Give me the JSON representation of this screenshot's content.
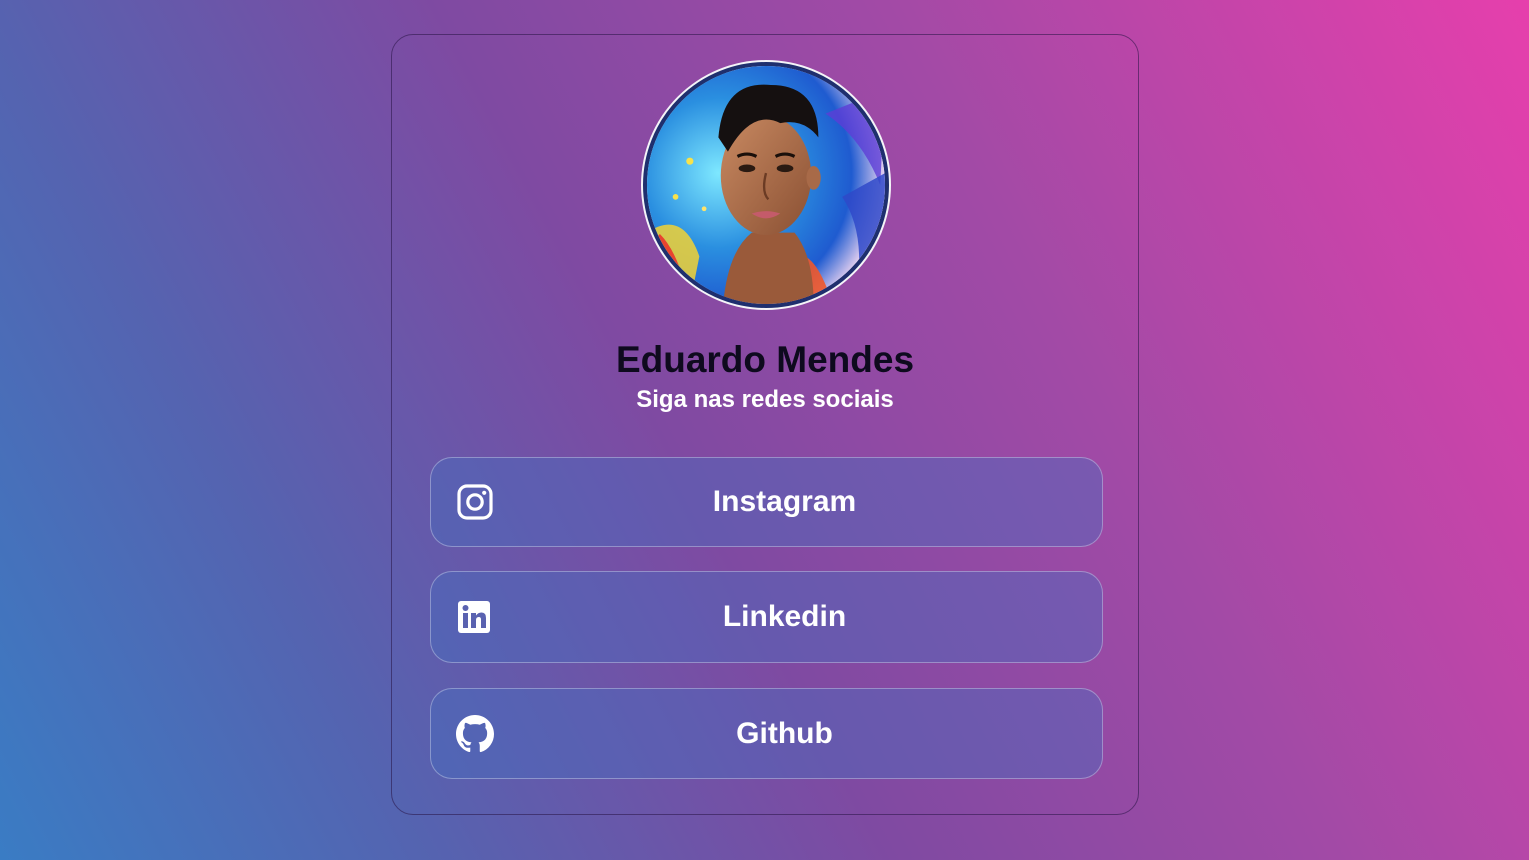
{
  "profile": {
    "name": "Eduardo Mendes",
    "subtitle": "Siga nas redes sociais",
    "avatar_icon": "profile-photo"
  },
  "links": [
    {
      "label": "Instagram",
      "icon": "instagram-icon"
    },
    {
      "label": "Linkedin",
      "icon": "linkedin-icon"
    },
    {
      "label": "Github",
      "icon": "github-icon"
    }
  ],
  "colors": {
    "background_start": "#3a7cc4",
    "background_end": "#e63fac",
    "name_text": "#0e0a1e",
    "button_text": "#ffffff"
  }
}
